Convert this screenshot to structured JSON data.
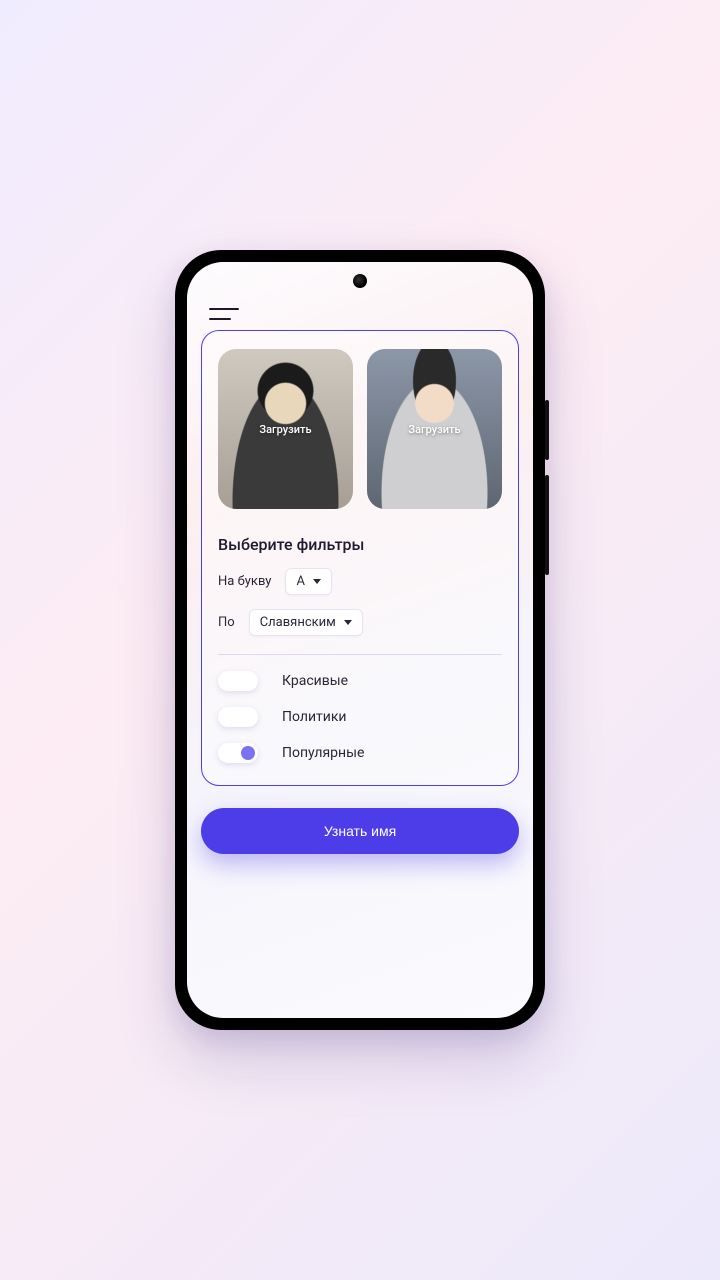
{
  "uploads": {
    "left_label": "Загрузить",
    "right_label": "Загрузить"
  },
  "filters": {
    "title": "Выберите фильтры",
    "letter": {
      "label": "На букву",
      "value": "А"
    },
    "origin": {
      "label": "По",
      "value": "Славянским"
    }
  },
  "toggles": [
    {
      "label": "Красивые",
      "on": false
    },
    {
      "label": "Политики",
      "on": false
    },
    {
      "label": "Популярные",
      "on": true
    }
  ],
  "cta_label": "Узнать имя"
}
